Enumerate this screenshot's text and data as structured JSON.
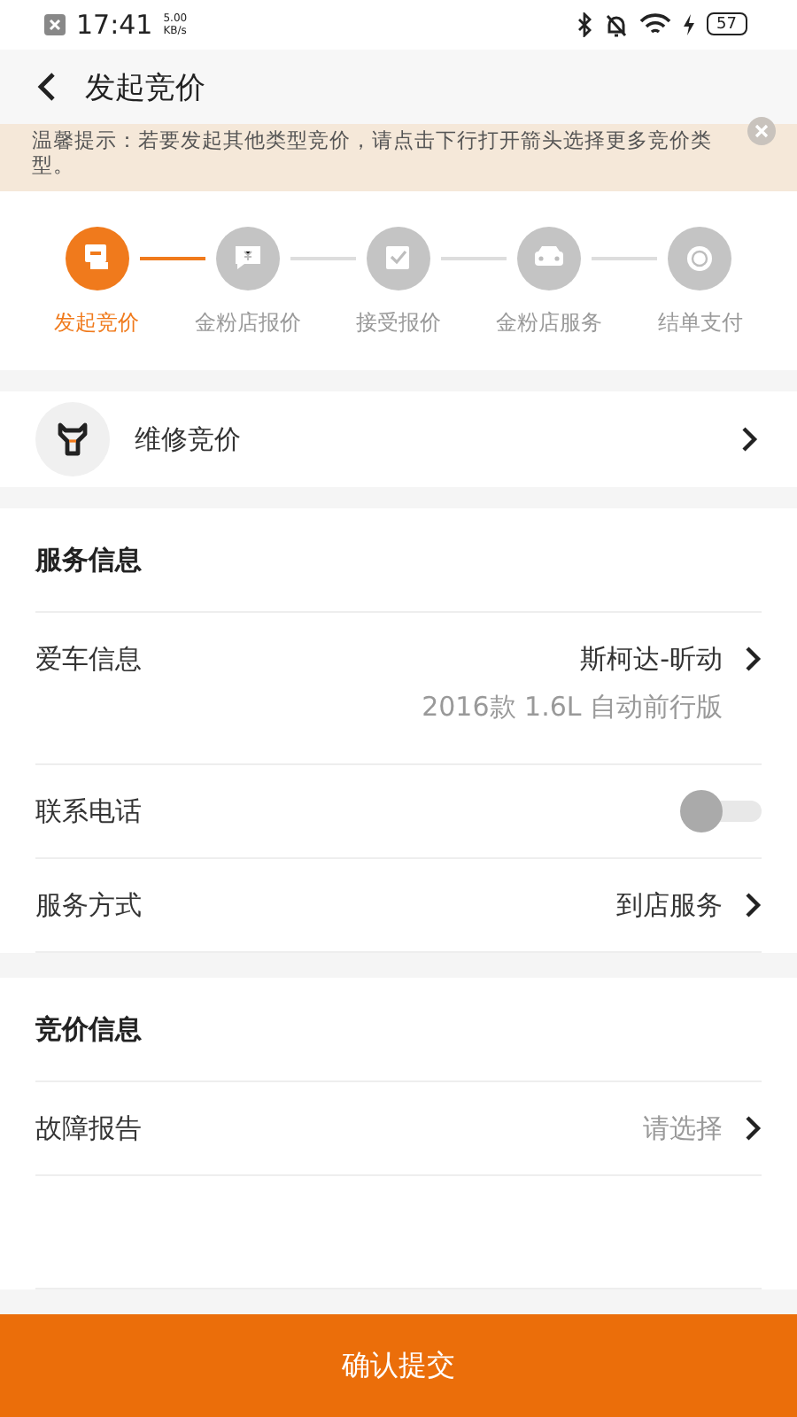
{
  "status_bar": {
    "time": "17:41",
    "speed": "5.00",
    "speed_unit": "KB/s",
    "battery": "57"
  },
  "header": {
    "title": "发起竞价"
  },
  "notice": {
    "text": "温馨提示：若要发起其他类型竞价，请点击下行打开箭头选择更多竞价类型。"
  },
  "steps": [
    {
      "label": "发起竞价",
      "active": true,
      "kind": "gavel"
    },
    {
      "label": "金粉店报价",
      "active": false,
      "kind": "quote"
    },
    {
      "label": "接受报价",
      "active": false,
      "kind": "check"
    },
    {
      "label": "金粉店服务",
      "active": false,
      "kind": "car"
    },
    {
      "label": "结单支付",
      "active": false,
      "kind": "coin"
    }
  ],
  "type_row": {
    "label": "维修竞价"
  },
  "service_info": {
    "title": "服务信息",
    "rows": [
      {
        "kind": "link",
        "label": "爱车信息",
        "value": "斯柯达-昕动",
        "sub": "2016款 1.6L 自动前行版"
      },
      {
        "kind": "toggle",
        "label": "联系电话",
        "on": false
      },
      {
        "kind": "link",
        "label": "服务方式",
        "value": "到店服务"
      }
    ]
  },
  "bid_info": {
    "title": "竞价信息",
    "rows": [
      {
        "kind": "link",
        "label": "故障报告",
        "value": "请选择",
        "placeholder": true
      }
    ]
  },
  "submit": {
    "label": "确认提交"
  }
}
